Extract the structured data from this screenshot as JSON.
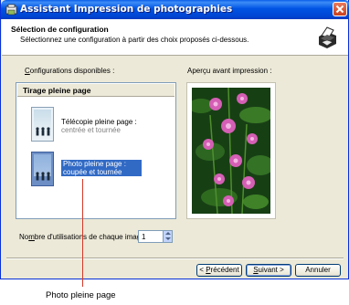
{
  "window": {
    "title": "Assistant Impression de photographies",
    "close_icon": "close-icon"
  },
  "header": {
    "title": "Sélection de configuration",
    "subtitle": "Sélectionnez une configuration à partir des choix proposés ci-dessous.",
    "icon": "printer-icon"
  },
  "configurations": {
    "label_underlined": "C",
    "label_rest": "onfigurations disponibles :",
    "group_title": "Tirage pleine page",
    "items": [
      {
        "title": "Télécopie pleine page :",
        "subtitle": "centrée et tournée",
        "selected": false
      },
      {
        "title": "Photo pleine page :",
        "subtitle": "coupée et tournée",
        "selected": true
      }
    ]
  },
  "preview": {
    "label": "Aperçu avant impression :"
  },
  "copies": {
    "label_before": "No",
    "label_underlined": "m",
    "label_after": "bre d'utilisations de chaque image :",
    "value": "1"
  },
  "buttons": {
    "back_prefix": "< ",
    "back_underlined": "P",
    "back_rest": "récédent",
    "next_underlined": "S",
    "next_rest": "uivant >",
    "cancel": "Annuler"
  },
  "caption": "Photo pleine page",
  "colors": {
    "titlebar": "#0054e3",
    "selection": "#316ac5",
    "callout_line": "#d43a2a"
  }
}
